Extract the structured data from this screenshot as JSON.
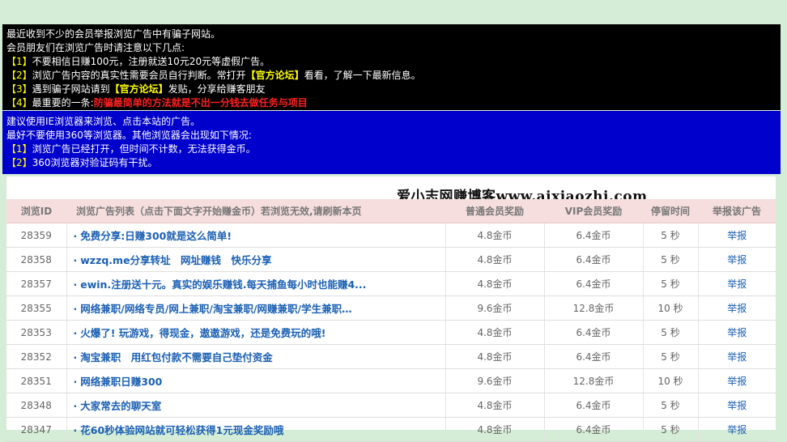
{
  "notice_black": {
    "line1": "最近收到不少的会员举报浏览广告中有骗子网站。",
    "line2": "会员朋友们在浏览广告时请注意以下几点:",
    "items": [
      {
        "prefix": "【1】",
        "text": "不要相信日赚100元，注册就送10元20元等虚假广告。"
      },
      {
        "prefix": "【2】",
        "text_a": "浏览广告内容的真实性需要会员自行判断。常打开",
        "link": "【官方论坛】",
        "text_b": "看看，了解一下最新信息。"
      },
      {
        "prefix": "【3】",
        "text_a": "遇到骗子网站请到",
        "link": "【官方论坛】",
        "text_b": "发贴，分享给赚客朋友"
      },
      {
        "prefix": "【4】",
        "text_a": "最重要的一条:",
        "text_red": "防骗最简单的方法就是不出一分钱去做任务与项目"
      }
    ]
  },
  "notice_blue": {
    "line1": "建议使用IE浏览器来浏览、点击本站的广告。",
    "line2": "最好不要使用360等浏览器。其他浏览器会出现如下情况:",
    "items": [
      {
        "prefix": "【1】",
        "text": "浏览广告已经打开，但时间不计数，无法获得金币。"
      },
      {
        "prefix": "【2】",
        "text": "360浏览器对验证码有干扰。"
      }
    ]
  },
  "brand": "爱小志网赚博客www.aixiaozhi.com",
  "table": {
    "headers": {
      "id": "浏览ID",
      "title": "浏览广告列表（点击下面文字开始赚金币）若浏览无效,请刷新本页",
      "normal": "普通会员奖励",
      "vip": "VIP会员奖励",
      "time": "停留时间",
      "report": "举报该广告"
    },
    "rows": [
      {
        "id": "28359",
        "title": "免费分享:日赚300就是这么简单!",
        "normal": "4.8金币",
        "vip": "6.4金币",
        "time": "5 秒",
        "report": "举报"
      },
      {
        "id": "28358",
        "title": "wzzq.me分享转址　网址赚钱　快乐分享",
        "normal": "4.8金币",
        "vip": "6.4金币",
        "time": "5 秒",
        "report": "举报"
      },
      {
        "id": "28357",
        "title": "ewin.注册送十元。真实的娱乐赚钱.每天捕鱼每小时也能赚4...",
        "normal": "4.8金币",
        "vip": "6.4金币",
        "time": "5 秒",
        "report": "举报"
      },
      {
        "id": "28355",
        "title": "网络兼职/网络专员/网上兼职/淘宝兼职/网赚兼职/学生兼职…",
        "normal": "9.6金币",
        "vip": "12.8金币",
        "time": "10 秒",
        "report": "举报"
      },
      {
        "id": "28353",
        "title": "火爆了! 玩游戏，得现金，遨遨游戏，还是免费玩的哦!",
        "normal": "4.8金币",
        "vip": "6.4金币",
        "time": "5 秒",
        "report": "举报"
      },
      {
        "id": "28352",
        "title": "淘宝兼职　用红包付款不需要自己垫付资金",
        "normal": "4.8金币",
        "vip": "6.4金币",
        "time": "5 秒",
        "report": "举报"
      },
      {
        "id": "28351",
        "title": "网络兼职日赚300",
        "normal": "9.6金币",
        "vip": "12.8金币",
        "time": "10 秒",
        "report": "举报"
      },
      {
        "id": "28348",
        "title": "大家常去的聊天室",
        "normal": "4.8金币",
        "vip": "6.4金币",
        "time": "5 秒",
        "report": "举报"
      },
      {
        "id": "28347",
        "title": "花60秒体验网站就可轻松获得1元现金奖励哦",
        "normal": "4.8金币",
        "vip": "6.4金币",
        "time": "5 秒",
        "report": "举报"
      }
    ]
  },
  "colors": {
    "page_bg": "#d5ecd6",
    "notice_black_bg": "#000000",
    "notice_blue_bg": "#0000cc",
    "highlight_yellow": "#ffff00",
    "warning_red": "#ff2020",
    "header_bg": "#f7dede",
    "link_blue": "#1a5fb4"
  }
}
